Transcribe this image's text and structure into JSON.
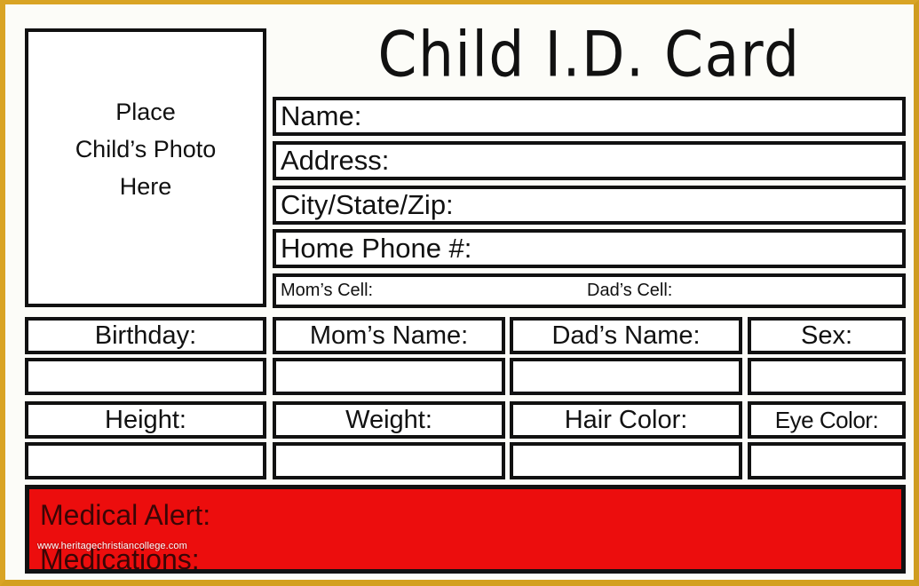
{
  "document": {
    "title": "Child I.D. Card",
    "watermark": "www.heritagechristiancollege.com"
  },
  "colors": {
    "frame": "#d9a425",
    "ink": "#111111",
    "alert_background": "#ec0d0d",
    "alert_text": "#3a0606",
    "paper": "#fcfcf8"
  },
  "photo": {
    "line1": "Place",
    "line2": "Child’s Photo",
    "line3": "Here"
  },
  "contact_fields": [
    {
      "label": "Name:",
      "value": ""
    },
    {
      "label": "Address:",
      "value": ""
    },
    {
      "label": "City/State/Zip:",
      "value": ""
    },
    {
      "label": "Home Phone #:",
      "value": ""
    }
  ],
  "cell_fields": {
    "mom_label": "Mom’s Cell:",
    "mom_value": "",
    "dad_label": "Dad’s Cell:",
    "dad_value": ""
  },
  "grid_row_1": [
    {
      "label": "Birthday:",
      "value": ""
    },
    {
      "label": "Mom’s Name:",
      "value": ""
    },
    {
      "label": "Dad’s Name:",
      "value": ""
    },
    {
      "label": "Sex:",
      "value": ""
    }
  ],
  "grid_row_2": [
    {
      "label": "Height:",
      "value": ""
    },
    {
      "label": "Weight:",
      "value": ""
    },
    {
      "label": "Hair Color:",
      "value": ""
    },
    {
      "label": "Eye Color:",
      "value": ""
    }
  ],
  "medical": {
    "alert_label": "Medical Alert:",
    "alert_value": "",
    "medications_label": "Medications:",
    "medications_value": ""
  }
}
